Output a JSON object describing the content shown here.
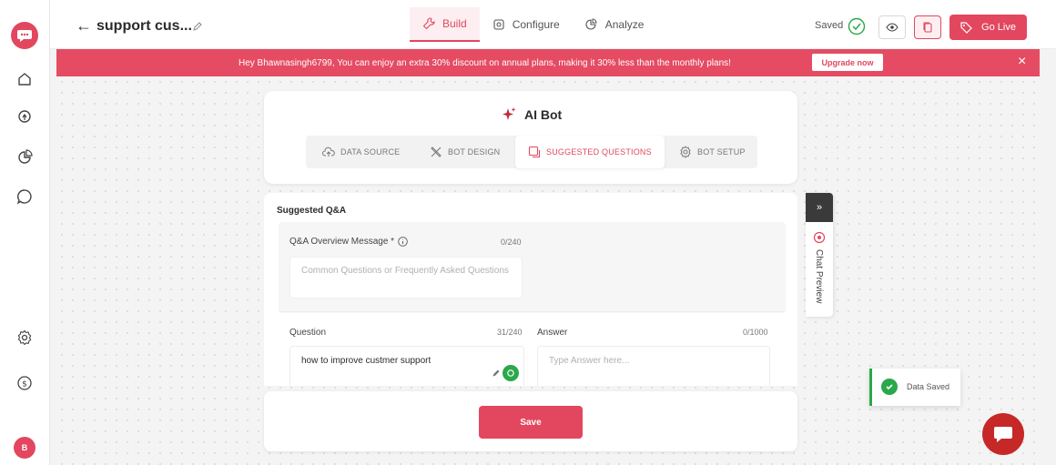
{
  "colors": {
    "brand": "#e2475f",
    "success": "#2aa84a",
    "fab": "#c62828"
  },
  "sidebar": {
    "logo": "chat-bubble-logo-icon",
    "items": [
      {
        "icon": "home-icon"
      },
      {
        "icon": "lightbulb-icon"
      },
      {
        "icon": "analytics-icon"
      },
      {
        "icon": "chat-icon"
      },
      {
        "icon": "settings-icon"
      },
      {
        "icon": "billing-icon"
      }
    ],
    "avatar_initial": "B"
  },
  "header": {
    "bot_name": "support cus...",
    "tabs": [
      {
        "label": "Build",
        "icon": "wrench-icon",
        "active": true
      },
      {
        "label": "Configure",
        "icon": "gear-icon",
        "active": false
      },
      {
        "label": "Analyze",
        "icon": "pie-chart-icon",
        "active": false
      }
    ],
    "saved_label": "Saved",
    "go_live_label": "Go Live"
  },
  "banner": {
    "text": "Hey Bhawnasingh6799, You can enjoy an extra 30% discount on annual plans, making it 30% less than the monthly plans!",
    "upgrade_label": "Upgrade now",
    "close": "×"
  },
  "builder": {
    "title": "AI Bot",
    "steps": [
      {
        "label": "DATA SOURCE",
        "icon": "data-source-icon",
        "active": false
      },
      {
        "label": "BOT DESIGN",
        "icon": "design-tools-icon",
        "active": false
      },
      {
        "label": "SUGGESTED QUESTIONS",
        "icon": "questions-icon",
        "active": true
      },
      {
        "label": "BOT SETUP",
        "icon": "gear-icon",
        "active": false
      }
    ]
  },
  "qa": {
    "section_title": "Suggested Q&A",
    "overview_label": "Q&A Overview Message *",
    "overview_counter": "0/240",
    "overview_placeholder": "Common Questions or Frequently Asked Questions",
    "question_label": "Question",
    "question_counter": "31/240",
    "question_value": "how to improve custmer support",
    "answer_label": "Answer",
    "answer_counter": "0/1000",
    "answer_placeholder": "Type Answer here..."
  },
  "save_label": "Save",
  "chat_preview": {
    "expand": "»",
    "label": "Chat Preview"
  },
  "toast": {
    "text": "Data Saved"
  }
}
